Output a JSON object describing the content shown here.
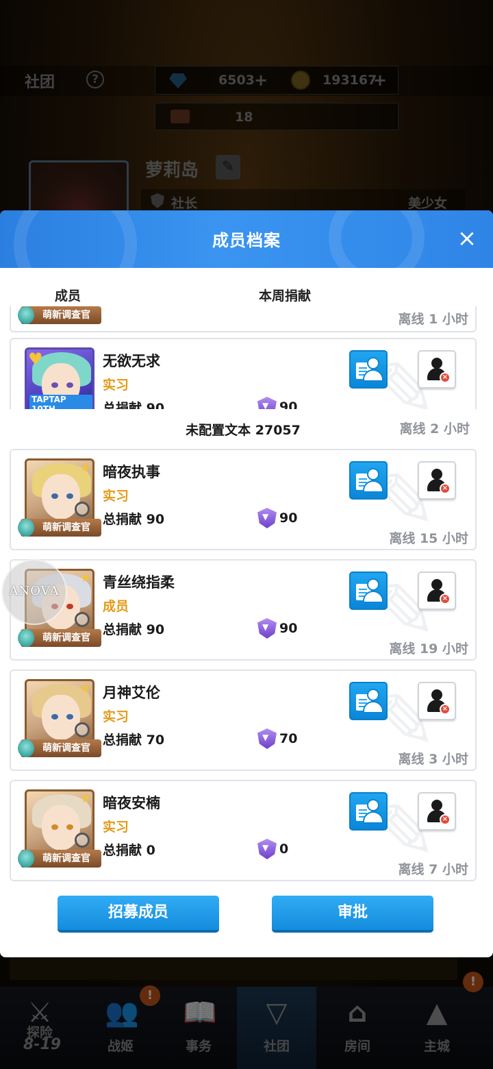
{
  "background": {
    "title": "社团",
    "help_icon": "?",
    "gems": "6503",
    "gems_plus": "+",
    "gold": "193167",
    "gold_plus": "+",
    "tickets": "18",
    "guild_name": "萝莉岛",
    "role": "社长",
    "member_title": "美少女"
  },
  "modal": {
    "title": "成员档案",
    "close_icon": "×",
    "col_member": "成员",
    "col_weekly": "本周捐献",
    "tooltip": "未配置文本 27057",
    "top_partial": {
      "avatar_tag": "萌新调查官",
      "offline": "离线 1 小时"
    },
    "members": [
      {
        "name": "无欲无求",
        "rank": "实习",
        "total": "总捐献 90",
        "weekly": "90",
        "offline": "离线 2 小时",
        "avatar_badge": "TAPTAP 10TH"
      },
      {
        "name": "暗夜执事",
        "rank": "实习",
        "total": "总捐献 90",
        "weekly": "90",
        "offline": "离线 15 小时",
        "avatar_tag": "萌新调查官"
      },
      {
        "name": "青丝绕指柔",
        "rank": "成员",
        "total": "总捐献 90",
        "weekly": "90",
        "offline": "离线 19 小时",
        "avatar_tag": "萌新调查官"
      },
      {
        "name": "月神艾伦",
        "rank": "实习",
        "total": "总捐献 70",
        "weekly": "70",
        "offline": "离线 3 小时",
        "avatar_tag": "萌新调查官"
      },
      {
        "name": "暗夜安楠",
        "rank": "实习",
        "total": "总捐献 0",
        "weekly": "0",
        "offline": "离线 7 小时",
        "avatar_tag": "萌新调查官"
      }
    ],
    "recruit_button": "招募成员",
    "approve_button": "审批"
  },
  "nav": {
    "stage": "8-19",
    "items": [
      {
        "label": "探险",
        "icon": "crossed-swords-icon"
      },
      {
        "label": "战姬",
        "icon": "people-icon"
      },
      {
        "label": "事务",
        "icon": "book-icon"
      },
      {
        "label": "社团",
        "icon": "guild-emblem-icon"
      },
      {
        "label": "房间",
        "icon": "house-icon"
      },
      {
        "label": "主城",
        "icon": "castle-icon"
      }
    ],
    "badge": "!"
  },
  "watermark": "ANOVA",
  "colors": {
    "header_blue": "#2f85e6",
    "rank_orange": "#e39a17",
    "button_blue": "#148cdd",
    "kick_red": "#e24a3b"
  }
}
